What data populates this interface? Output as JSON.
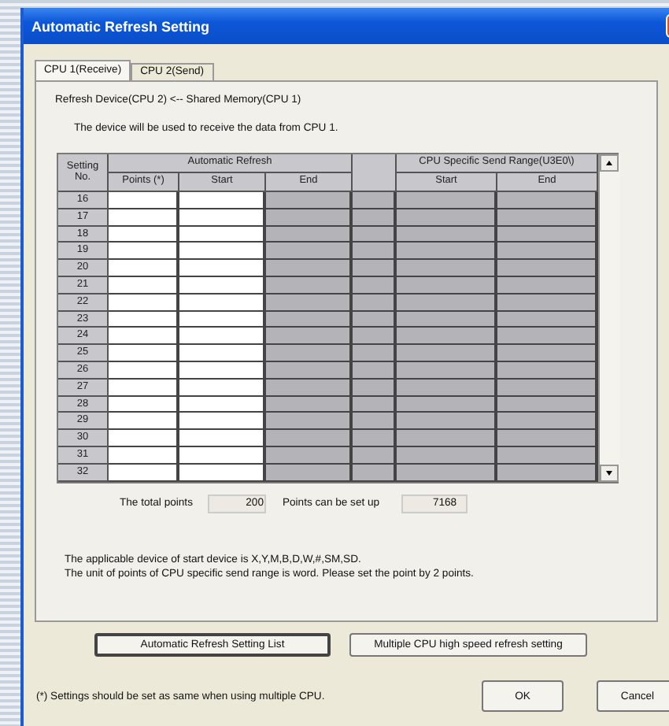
{
  "window": {
    "title": "Automatic Refresh Setting"
  },
  "tabs": [
    {
      "label": "CPU 1(Receive)",
      "selected": true
    },
    {
      "label": "CPU 2(Send)",
      "selected": false
    }
  ],
  "direction": "Refresh Device(CPU 2) <-- Shared Memory(CPU 1)",
  "description": "The device will be used to receive the data from CPU 1.",
  "table": {
    "number_header": [
      "Setting",
      "No."
    ],
    "groups": [
      {
        "label": "Automatic Refresh",
        "columns": [
          {
            "label": "Points (*)",
            "editable": true
          },
          {
            "label": "Start",
            "editable": true
          },
          {
            "label": "End",
            "editable": false
          }
        ]
      },
      {
        "columns": [
          {
            "editable": false
          }
        ]
      },
      {
        "label": "CPU Specific Send Range(U3E0\\)",
        "columns": [
          {
            "label": "Start",
            "editable": false
          },
          {
            "label": "End",
            "editable": false
          }
        ]
      }
    ],
    "rows": [
      "16",
      "17",
      "18",
      "19",
      "20",
      "21",
      "22",
      "23",
      "24",
      "25",
      "26",
      "27",
      "28",
      "29",
      "30",
      "31",
      "32"
    ]
  },
  "totals": [
    {
      "label": "The total points",
      "value": "200"
    },
    {
      "label": "Points can be set up",
      "value": "7168"
    }
  ],
  "notes": [
    "The applicable device of start device is X,Y,M,B,D,W,#,SM,SD.",
    "The unit of points of CPU specific send range is word. Please set the point by 2 points."
  ],
  "buttons": [
    "Automatic Refresh Setting List",
    "Multiple CPU high speed refresh setting"
  ],
  "footnote": "(*) Settings should be set as same when using multiple CPU.",
  "dialog_buttons": [
    "OK",
    "Cancel"
  ]
}
